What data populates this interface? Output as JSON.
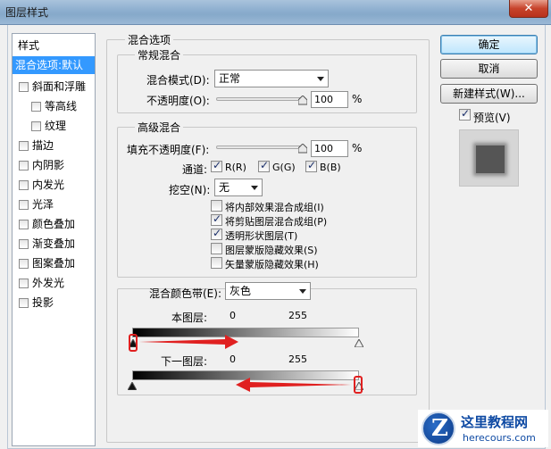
{
  "window": {
    "title": "图层样式",
    "close": "✕"
  },
  "style_list": {
    "header": "样式",
    "items": [
      {
        "label": "混合选项:默认",
        "checkbox": false,
        "selected": true
      },
      {
        "label": "斜面和浮雕",
        "checkbox": true
      },
      {
        "label": "等高线",
        "checkbox": true,
        "indent": true
      },
      {
        "label": "纹理",
        "checkbox": true,
        "indent": true
      },
      {
        "label": "描边",
        "checkbox": true
      },
      {
        "label": "内阴影",
        "checkbox": true
      },
      {
        "label": "内发光",
        "checkbox": true
      },
      {
        "label": "光泽",
        "checkbox": true
      },
      {
        "label": "颜色叠加",
        "checkbox": true
      },
      {
        "label": "渐变叠加",
        "checkbox": true
      },
      {
        "label": "图案叠加",
        "checkbox": true
      },
      {
        "label": "外发光",
        "checkbox": true
      },
      {
        "label": "投影",
        "checkbox": true
      }
    ]
  },
  "blend_options": {
    "title": "混合选项",
    "general": {
      "title": "常规混合",
      "mode_label": "混合模式(D):",
      "mode_value": "正常",
      "opacity_label": "不透明度(O):",
      "opacity_value": "100",
      "percent": "%"
    },
    "advanced": {
      "title": "高级混合",
      "fill_label": "填充不透明度(F):",
      "fill_value": "100",
      "percent": "%",
      "channels_label": "通道:",
      "channels": [
        {
          "label": "R(R)",
          "checked": true
        },
        {
          "label": "G(G)",
          "checked": true
        },
        {
          "label": "B(B)",
          "checked": true
        }
      ],
      "knockout_label": "挖空(N):",
      "knockout_value": "无",
      "options": [
        {
          "label": "将内部效果混合成组(I)",
          "checked": false
        },
        {
          "label": "将剪贴图层混合成组(P)",
          "checked": true
        },
        {
          "label": "透明形状图层(T)",
          "checked": true
        },
        {
          "label": "图层蒙版隐藏效果(S)",
          "checked": false
        },
        {
          "label": "矢量蒙版隐藏效果(H)",
          "checked": false
        }
      ]
    },
    "blend_if": {
      "label": "混合颜色带(E):",
      "value": "灰色",
      "this_layer": {
        "label": "本图层:",
        "min": "0",
        "max": "255"
      },
      "underlying_layer": {
        "label": "下一图层:",
        "min": "0",
        "max": "255"
      }
    }
  },
  "buttons": {
    "ok": "确定",
    "cancel": "取消",
    "new_style": "新建样式(W)...",
    "preview_label": "预览(V)",
    "preview_checked": true
  },
  "watermark": {
    "site_name": "这里教程网",
    "site_url": "herecours.com",
    "badge_letter": "Z"
  },
  "colors": {
    "selection": "#3399ff",
    "annotation_red": "#e02020",
    "watermark_blue": "#0e4aa3"
  }
}
